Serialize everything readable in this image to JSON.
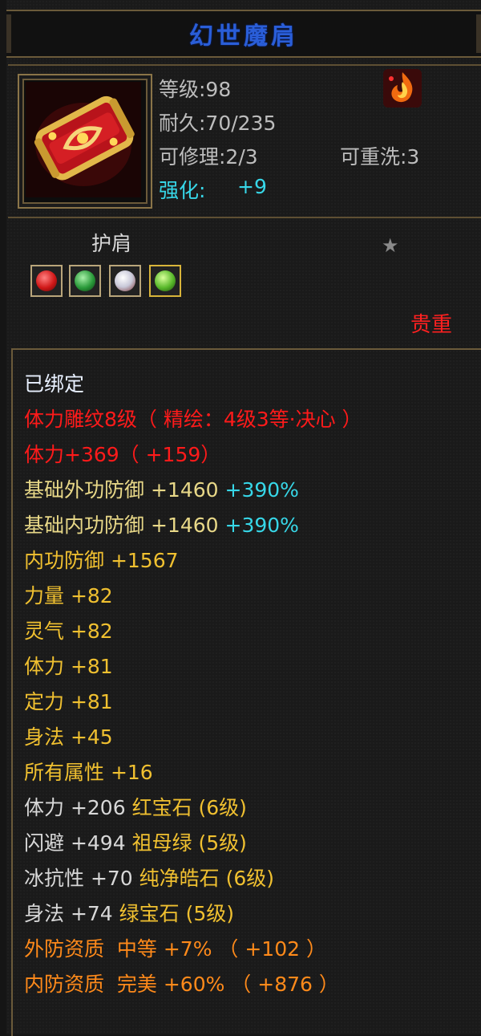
{
  "title": "幻世魔肩",
  "item": {
    "icon_name": "red-gold-scroll-pauldron-icon",
    "level_label": "等级:98",
    "durability_label": "耐久:70/235",
    "repairable_label": "可修理:2/3",
    "rewashable_label": "可重洗:3",
    "enhance_label": "强化:",
    "enhance_value": "+9",
    "badge_icon": "flame-badge-icon"
  },
  "type_label": "护肩",
  "star_icon": "star-icon",
  "gems": [
    {
      "icon": "red-gem-icon",
      "color": "#d01818"
    },
    {
      "icon": "green-gem-icon",
      "color": "#2a9a3a"
    },
    {
      "icon": "white-gem-icon",
      "color": "#c8c8d8"
    },
    {
      "icon": "lime-gem-icon",
      "color": "#58b82a"
    }
  ],
  "rarity": "贵重",
  "bind_status": "已绑定",
  "engrave": "体力雕纹8级（ 精绘：4级3等·决心 ）",
  "stamina_bonus": "体力+369（ +159）",
  "base_stats": [
    {
      "name": "基础外功防御",
      "value": "+1460",
      "pct": "+390%"
    },
    {
      "name": "基础内功防御",
      "value": "+1460",
      "pct": "+390%"
    }
  ],
  "attributes": [
    "内功防御 +1567",
    "力量 +82",
    "灵气 +82",
    "体力 +81",
    "定力 +81",
    "身法 +45",
    "所有属性 +16"
  ],
  "gem_stats": [
    {
      "stat": "体力 +206",
      "gem": "红宝石 (6级)"
    },
    {
      "stat": "闪避 +494",
      "gem": "祖母绿 (5级)"
    },
    {
      "stat": "冰抗性 +70",
      "gem": "纯净皓石 (6级)"
    },
    {
      "stat": "身法 +74",
      "gem": "绿宝石 (5级)"
    }
  ],
  "qualities": [
    "外防资质  中等 +7% （ +102 ）",
    "内防资质  完美 +60% （ +876 ）"
  ],
  "colors": {
    "title": "#2a5ed8",
    "red": "#ff1a1a",
    "gold": "#f0c030",
    "cyan": "#37d7e8",
    "orange": "#ff8a1a"
  }
}
